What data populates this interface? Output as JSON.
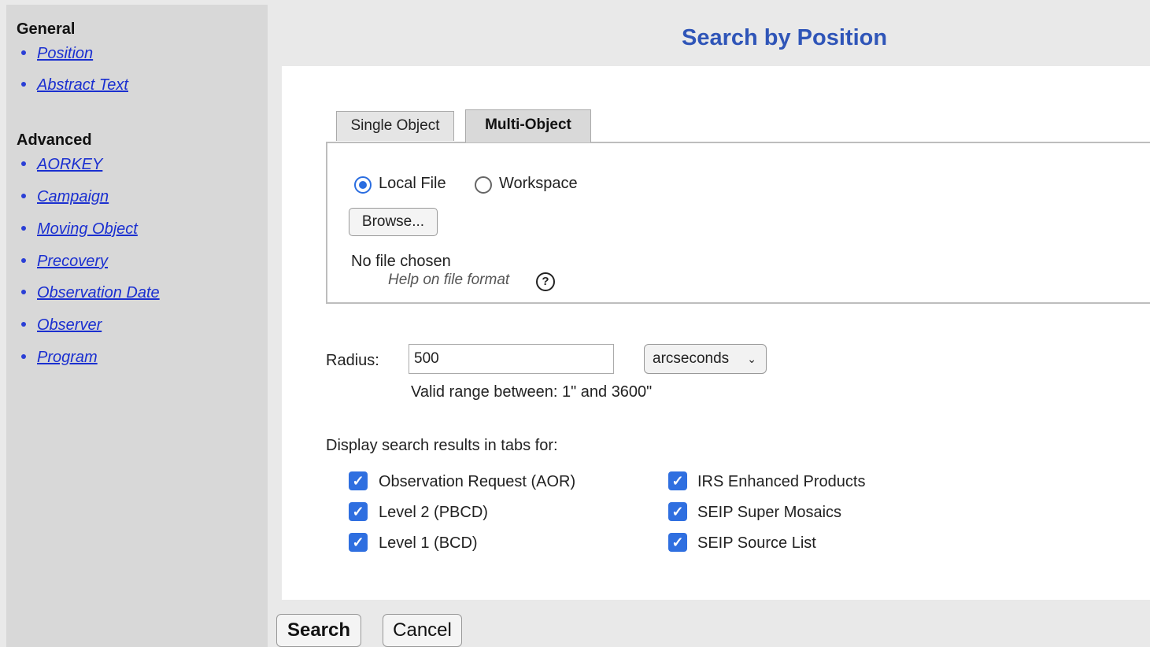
{
  "sidebar": {
    "general_heading": "General",
    "general_items": [
      {
        "label": "Position"
      },
      {
        "label": "Abstract Text"
      }
    ],
    "advanced_heading": "Advanced",
    "advanced_items": [
      {
        "label": "AORKEY"
      },
      {
        "label": "Campaign"
      },
      {
        "label": "Moving Object"
      },
      {
        "label": "Precovery"
      },
      {
        "label": "Observation Date"
      },
      {
        "label": "Observer"
      },
      {
        "label": "Program"
      }
    ]
  },
  "page": {
    "title": "Search by Position"
  },
  "tabs": [
    {
      "label": "Single Object",
      "active": false
    },
    {
      "label": "Multi-Object",
      "active": true
    }
  ],
  "source": {
    "options": [
      {
        "label": "Local File",
        "checked": true
      },
      {
        "label": "Workspace",
        "checked": false
      }
    ],
    "browse_label": "Browse...",
    "file_status": "No file chosen",
    "help_text": "Help on file format",
    "help_icon": "question-circle-icon"
  },
  "radius": {
    "label": "Radius:",
    "value": "500",
    "unit": "arcseconds",
    "hint": "Valid range between: 1\" and 3600\""
  },
  "results": {
    "label": "Display search results in tabs for:",
    "left_options": [
      {
        "label": "Observation Request (AOR)",
        "checked": true
      },
      {
        "label": "Level 2 (PBCD)",
        "checked": true
      },
      {
        "label": "Level 1 (BCD)",
        "checked": true
      }
    ],
    "right_options": [
      {
        "label": "IRS Enhanced Products",
        "checked": true
      },
      {
        "label": "SEIP Super Mosaics",
        "checked": true
      },
      {
        "label": "SEIP Source List",
        "checked": true
      }
    ]
  },
  "actions": {
    "search_label": "Search",
    "cancel_label": "Cancel"
  },
  "colors": {
    "accent": "#2f6fe0",
    "title": "#2f55b8",
    "link": "#1a2fd0"
  }
}
